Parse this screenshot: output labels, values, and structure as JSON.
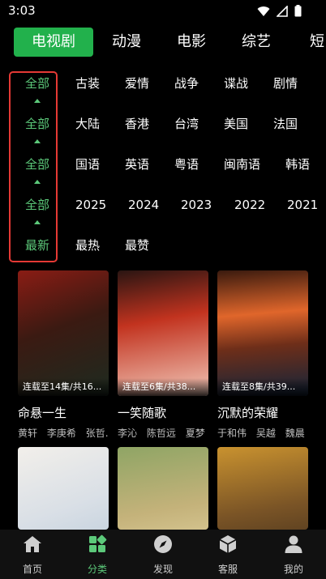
{
  "status_bar": {
    "time": "3:03"
  },
  "tabs": [
    {
      "label": "电视剧"
    },
    {
      "label": "动漫"
    },
    {
      "label": "电影"
    },
    {
      "label": "综艺"
    },
    {
      "label": "短"
    }
  ],
  "filters": {
    "genre": [
      "全部",
      "古装",
      "爱情",
      "战争",
      "谍战",
      "剧情"
    ],
    "region": [
      "全部",
      "大陆",
      "香港",
      "台湾",
      "美国",
      "法国"
    ],
    "language": [
      "全部",
      "国语",
      "英语",
      "粤语",
      "闽南语",
      "韩语"
    ],
    "year": [
      "全部",
      "2025",
      "2024",
      "2023",
      "2022",
      "2021"
    ],
    "sort": [
      "最新",
      "最热",
      "最赞"
    ]
  },
  "posters": [
    {
      "title": "命悬一生",
      "badge": "连载至14集/共16...",
      "cast": [
        "黄轩",
        "李庚希",
        "张哲..."
      ],
      "color1": "#8a1c14",
      "color2": "#1d2b20"
    },
    {
      "title": "一笑随歌",
      "badge": "连载至6集/共38...",
      "cast": [
        "李沁",
        "陈哲远",
        "夏梦"
      ],
      "color1": "#c2331f",
      "color2": "#f1c7b8"
    },
    {
      "title": "沉默的荣耀",
      "badge": "连载至8集/共39...",
      "cast": [
        "于和伟",
        "吴越",
        "魏晨"
      ],
      "color1": "#e0662b",
      "color2": "#12243a"
    },
    {
      "title": "",
      "badge": "",
      "cast": [],
      "color1": "#f2efea",
      "color2": "#b7c9d8"
    },
    {
      "title": "",
      "badge": "",
      "cast": [],
      "color1": "#8fa565",
      "color2": "#e8d9a8"
    },
    {
      "title": "",
      "badge": "",
      "cast": [],
      "color1": "#c9922f",
      "color2": "#3a2a1a"
    }
  ],
  "nav": [
    {
      "label": "首页",
      "icon": "home-icon"
    },
    {
      "label": "分类",
      "icon": "category-icon"
    },
    {
      "label": "发现",
      "icon": "compass-icon"
    },
    {
      "label": "客服",
      "icon": "cube-icon"
    },
    {
      "label": "我的",
      "icon": "user-icon"
    }
  ],
  "colors": {
    "accent": "#22b14c",
    "active_text": "#5cc97a",
    "highlight_border": "#e53935"
  }
}
